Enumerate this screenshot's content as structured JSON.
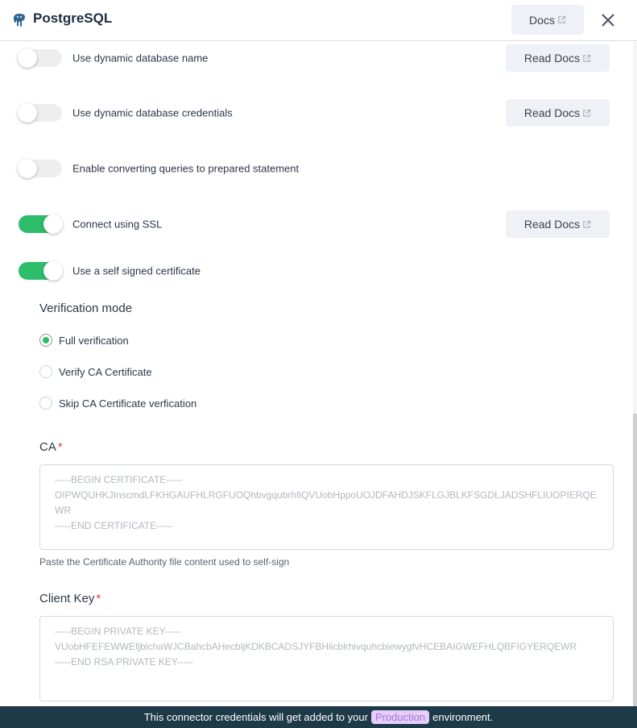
{
  "header": {
    "title": "PostgreSQL",
    "logo_icon": "postgresql-elephant-icon",
    "docs_label": "Docs",
    "close_icon": "close-icon"
  },
  "toggles": [
    {
      "label": "Use dynamic database name",
      "on": false,
      "read_docs": "Read Docs"
    },
    {
      "label": "Use dynamic database credentials",
      "on": false,
      "read_docs": "Read Docs"
    },
    {
      "label": "Enable converting queries to prepared statement",
      "on": false,
      "read_docs": null
    },
    {
      "label": "Connect using SSL",
      "on": true,
      "read_docs": "Read Docs"
    },
    {
      "label": "Use a self signed certificate",
      "on": true,
      "read_docs": null
    }
  ],
  "verification": {
    "title": "Verification mode",
    "options": [
      {
        "label": "Full verification",
        "checked": true
      },
      {
        "label": "Verify CA Certificate",
        "checked": false
      },
      {
        "label": "Skip CA Certificate verfication",
        "checked": false
      }
    ]
  },
  "ca": {
    "label": "CA",
    "required_mark": "*",
    "placeholder": "-----BEGIN CERTIFICATE-----\nOIPWQUHKJInscmdLFKHGAUFHLRGFUOQhbvgqubrhfiQVUobHppoUOJDFAHDJSKFLGJBLKFSGDLJADSHFLIUOPIERQEWR\n-----END CERTIFICATE-----",
    "helper": "Paste the Certificate Authority file content used to self-sign"
  },
  "client_key": {
    "label": "Client Key",
    "required_mark": "*",
    "placeholder": "-----BEGIN PRIVATE KEY-----\nVUobHFEFEWWEfjblchaWJCBahcbAHecbljKDKBCADSJYFBHiicblrhivquhcbiewygfvHCEBAIGWEFHLQBFIGYERQEWR\n-----END RSA PRIVATE KEY-----"
  },
  "footer": {
    "text_before": "This connector credentials will get added to your",
    "environment": "Production",
    "text_after": "environment."
  },
  "colors": {
    "toggle_on": "#2ebd6b",
    "footer_bg": "#1e3a48",
    "env_badge_bg": "#e6cdfa",
    "env_badge_text": "#a57ad6",
    "required": "#e53e3e"
  }
}
